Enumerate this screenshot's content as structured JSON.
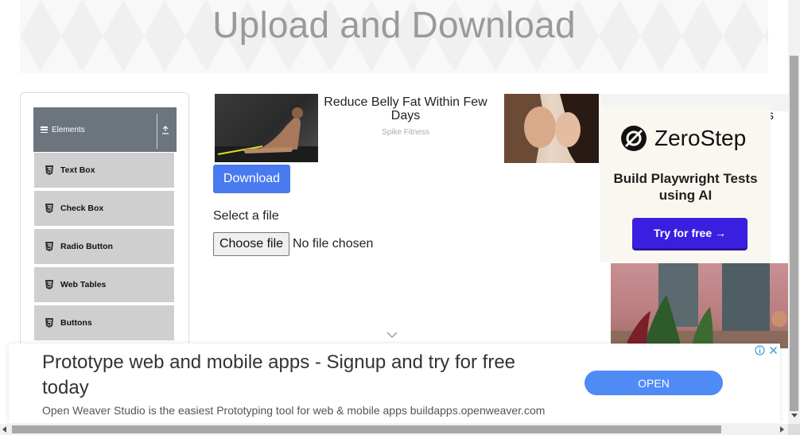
{
  "header": {
    "title": "Upload and Download"
  },
  "sidebar": {
    "group_label": "Elements",
    "items": [
      {
        "label": "Text Box"
      },
      {
        "label": "Check Box"
      },
      {
        "label": "Radio Button"
      },
      {
        "label": "Web Tables"
      },
      {
        "label": "Buttons"
      }
    ]
  },
  "ads": {
    "fitness": {
      "title": "Reduce Belly Fat Within Few Days",
      "source": "Spike Fitness"
    },
    "zerostep": {
      "brand": "ZeroStep",
      "tagline": "Build Playwright Tests using AI",
      "cta": "Try for free →",
      "partial_text": "s"
    },
    "bottom": {
      "headline": "Prototype web and mobile apps - Signup and try for free today",
      "description": "Open Weaver Studio is the easiest Prototyping tool for web & mobile apps buildapps.openweaver.com",
      "cta": "OPEN"
    }
  },
  "main": {
    "download_label": "Download",
    "select_file_label": "Select a file",
    "choose_file_label": "Choose file",
    "no_file_text": "No file chosen"
  },
  "colors": {
    "primary_button": "#4a7af0",
    "sidebar_header": "#6c757d",
    "sidebar_item": "#cfcfcf",
    "zerostep_cta": "#3a1fe0",
    "ad_open_button": "#4f8bf5"
  }
}
